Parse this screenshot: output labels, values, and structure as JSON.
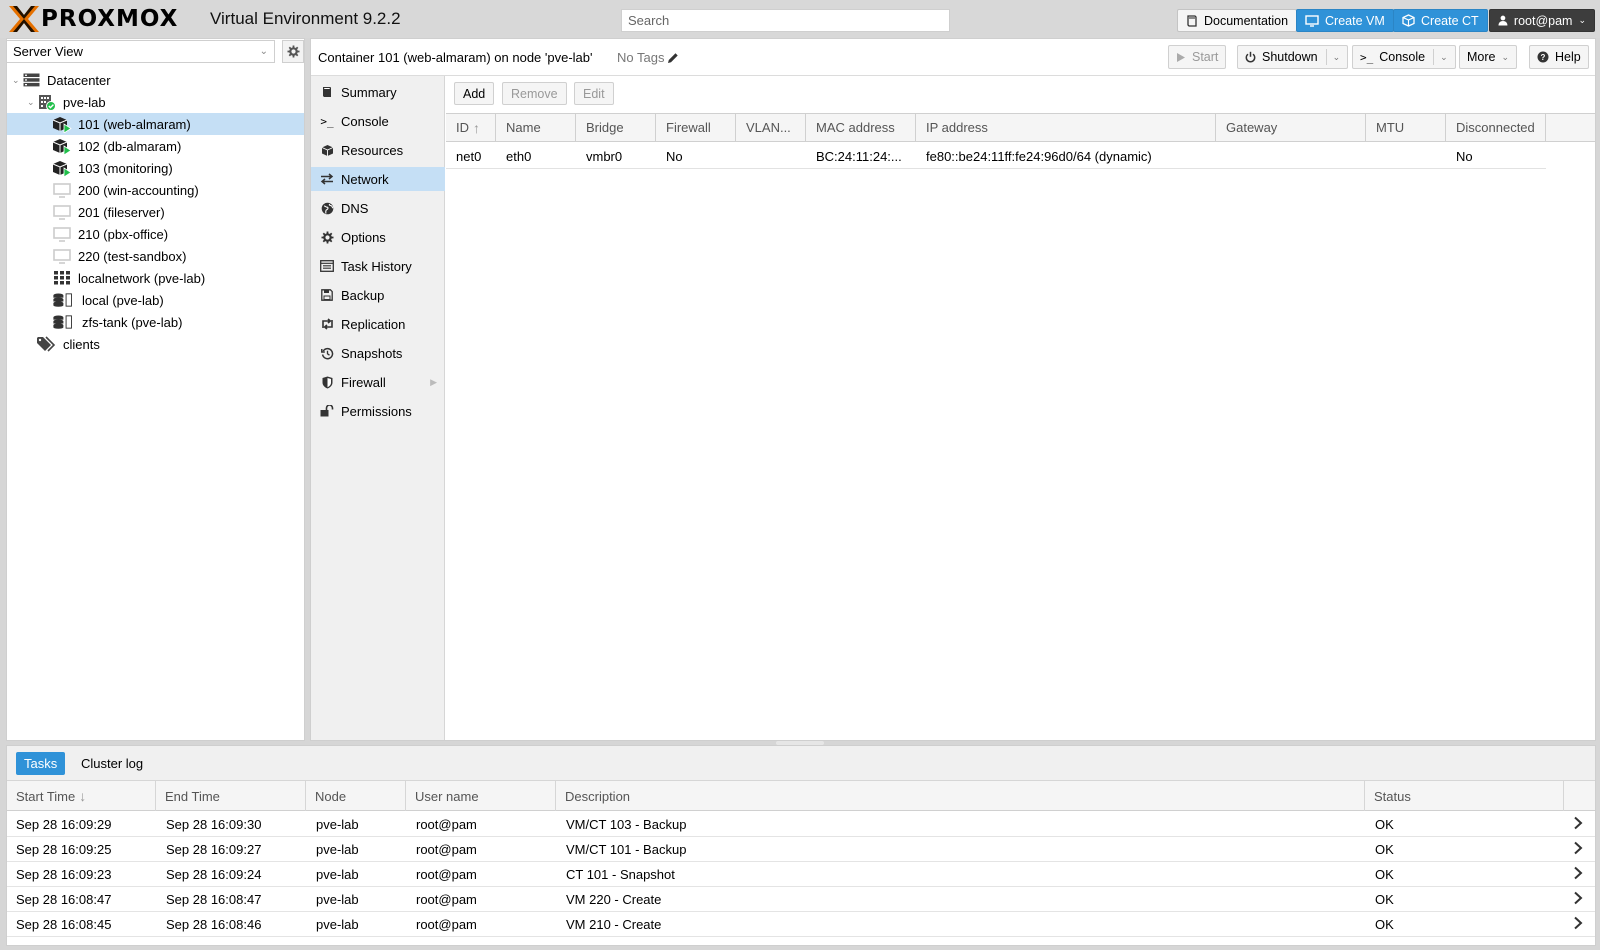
{
  "header": {
    "brand": "PROXMOX",
    "version": "Virtual Environment 9.2.2",
    "search_placeholder": "Search",
    "documentation": "Documentation",
    "create_vm": "Create VM",
    "create_ct": "Create CT",
    "user": "root@pam"
  },
  "sidebar": {
    "view": "Server View",
    "tree": [
      {
        "label": "Datacenter",
        "icon": "datacenter-icon"
      },
      {
        "label": "pve-lab",
        "icon": "node-online-icon"
      },
      {
        "label": "101 (web-almaram)",
        "icon": "container-running-icon"
      },
      {
        "label": "102 (db-almaram)",
        "icon": "container-running-icon"
      },
      {
        "label": "103 (monitoring)",
        "icon": "container-running-icon"
      },
      {
        "label": "200 (win-accounting)",
        "icon": "vm-stopped-icon"
      },
      {
        "label": "201 (fileserver)",
        "icon": "vm-stopped-icon"
      },
      {
        "label": "210 (pbx-office)",
        "icon": "vm-stopped-icon"
      },
      {
        "label": "220 (test-sandbox)",
        "icon": "vm-stopped-icon"
      },
      {
        "label": "localnetwork (pve-lab)",
        "icon": "sdn-zone-icon"
      },
      {
        "label": "local (pve-lab)",
        "icon": "storage-icon"
      },
      {
        "label": "zfs-tank (pve-lab)",
        "icon": "storage-icon"
      },
      {
        "label": "clients",
        "icon": "tags-icon"
      }
    ]
  },
  "content": {
    "title": "Container 101 (web-almaram) on node 'pve-lab'",
    "tags": "No Tags",
    "toolbar": {
      "start": "Start",
      "shutdown": "Shutdown",
      "console": "Console",
      "more": "More",
      "help": "Help"
    },
    "menu": [
      {
        "label": "Summary",
        "icon": "book-icon"
      },
      {
        "label": "Console",
        "icon": "terminal-icon"
      },
      {
        "label": "Resources",
        "icon": "cube-icon"
      },
      {
        "label": "Network",
        "icon": "exchange-icon"
      },
      {
        "label": "DNS",
        "icon": "globe-icon"
      },
      {
        "label": "Options",
        "icon": "gear-icon"
      },
      {
        "label": "Task History",
        "icon": "list-icon"
      },
      {
        "label": "Backup",
        "icon": "floppy-icon"
      },
      {
        "label": "Replication",
        "icon": "retweet-icon"
      },
      {
        "label": "Snapshots",
        "icon": "history-icon"
      },
      {
        "label": "Firewall",
        "icon": "shield-icon"
      },
      {
        "label": "Permissions",
        "icon": "unlock-icon"
      }
    ],
    "grid": {
      "buttons": {
        "add": "Add",
        "remove": "Remove",
        "edit": "Edit"
      },
      "columns": [
        "ID",
        "Name",
        "Bridge",
        "Firewall",
        "VLAN...",
        "MAC address",
        "IP address",
        "Gateway",
        "MTU",
        "Disconnected"
      ],
      "rows": [
        [
          "net0",
          "eth0",
          "vmbr0",
          "No",
          "",
          "BC:24:11:24:...",
          "fe80::be24:11ff:fe24:96d0/64 (dynamic)",
          "",
          "",
          "No"
        ]
      ]
    }
  },
  "tasks": {
    "tabs": {
      "tasks": "Tasks",
      "cluster_log": "Cluster log"
    },
    "columns": [
      "Start Time",
      "End Time",
      "Node",
      "User name",
      "Description",
      "Status"
    ],
    "rows": [
      [
        "Sep 28 16:09:29",
        "Sep 28 16:09:30",
        "pve-lab",
        "root@pam",
        "VM/CT 103 - Backup",
        "OK"
      ],
      [
        "Sep 28 16:09:25",
        "Sep 28 16:09:27",
        "pve-lab",
        "root@pam",
        "VM/CT 101 - Backup",
        "OK"
      ],
      [
        "Sep 28 16:09:23",
        "Sep 28 16:09:24",
        "pve-lab",
        "root@pam",
        "CT 101 - Snapshot",
        "OK"
      ],
      [
        "Sep 28 16:08:47",
        "Sep 28 16:08:47",
        "pve-lab",
        "root@pam",
        "VM 220 - Create",
        "OK"
      ],
      [
        "Sep 28 16:08:45",
        "Sep 28 16:08:46",
        "pve-lab",
        "root@pam",
        "VM 210 - Create",
        "OK"
      ]
    ]
  },
  "colors": {
    "accent": "#2f92d8",
    "selection": "#c5dff5",
    "logo_orange": "#e57000",
    "running": "#21bf4b"
  }
}
